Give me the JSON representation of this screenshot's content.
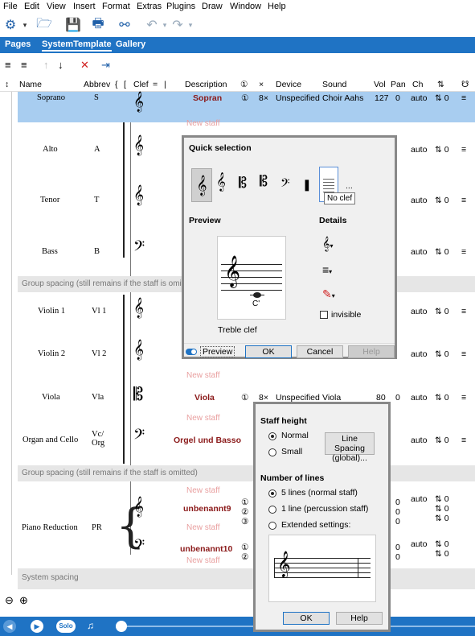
{
  "menubar": {
    "items": [
      "File",
      "Edit",
      "View",
      "Insert",
      "Format",
      "Extras",
      "Plugins",
      "Draw",
      "Window",
      "Help"
    ]
  },
  "tabs": [
    "Pages",
    "SystemTemplate",
    "Gallery"
  ],
  "columns": {
    "name": "Name",
    "abbrev": "Abbrev",
    "clef": "Clef",
    "description": "Description",
    "device": "Device",
    "sound": "Sound",
    "vol": "Vol",
    "pan": "Pan",
    "ch": "Ch"
  },
  "rows": [
    {
      "name": "Soprano",
      "abbrev": "S",
      "staff": "Sopran",
      "idx": "①",
      "mult": "8×",
      "device": "Unspecified",
      "sound": "Choir Aahs",
      "vol": "127",
      "pan": "0",
      "ch": "auto",
      "tr": "0",
      "selected": true
    },
    {
      "name": "Alto",
      "abbrev": "A",
      "ch": "auto",
      "tr": "0"
    },
    {
      "name": "Tenor",
      "abbrev": "T",
      "ch": "auto",
      "tr": "0"
    },
    {
      "name": "Bass",
      "abbrev": "B",
      "ch": "auto",
      "tr": "0"
    },
    {
      "name": "Violin 1",
      "abbrev": "Vl 1",
      "ch": "auto",
      "tr": "0"
    },
    {
      "name": "Violin 2",
      "abbrev": "Vl 2",
      "ch": "auto",
      "tr": "0"
    },
    {
      "name": "Viola",
      "abbrev": "Vla",
      "staff": "Viola",
      "idx": "①",
      "mult": "8×",
      "device": "Unspecified",
      "sound": "Viola",
      "vol": "80",
      "pan": "0",
      "ch": "auto",
      "tr": "0"
    },
    {
      "name": "Organ and Cello",
      "abbrev": "Vc/ Org",
      "staff": "Orgel und Basso",
      "ch": "auto",
      "tr": "0"
    },
    {
      "name": "Piano Reduction",
      "abbrev": "PR",
      "staff1": "unbenannt9",
      "staff2": "unbenannt10"
    }
  ],
  "new_staff": "New staff",
  "group_spacing": "Group spacing (still remains if the staff is omitted)",
  "system_spacing": "System spacing",
  "clef_dialog": {
    "quick_selection": "Quick selection",
    "tooltip": "No clef",
    "more": "...",
    "preview": "Preview",
    "details": "Details",
    "note_label": "C'",
    "clef_name": "Treble clef",
    "invisible": "invisible",
    "preview_toggle": "Preview",
    "ok": "OK",
    "cancel": "Cancel",
    "help": "Help"
  },
  "staff_dialog": {
    "staff_height": "Staff height",
    "normal": "Normal",
    "small": "Small",
    "line_spacing": "Line Spacing (global)...",
    "number_of_lines": "Number of lines",
    "five_lines": "5 lines (normal staff)",
    "one_line": "1 line (percussion staff)",
    "extended": "Extended settings:",
    "ok": "OK",
    "help": "Help"
  },
  "playbar": {
    "solo": "Solo"
  },
  "colors": {
    "accent": "#1f73c4",
    "selected_row": "#a8cdf0",
    "staff_name": "#8b1a1a"
  }
}
